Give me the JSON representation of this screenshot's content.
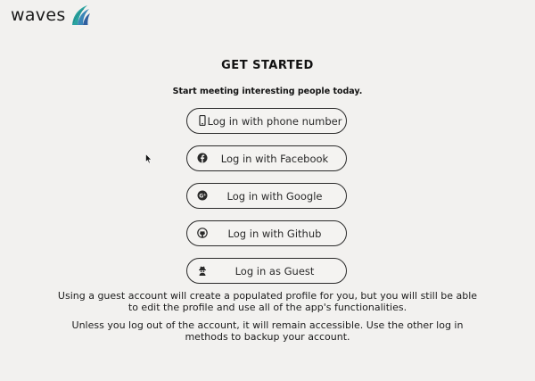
{
  "brand": {
    "name": "waves",
    "logo_icon": "waves-logo-icon"
  },
  "header": {
    "title": "GET STARTED",
    "subtitle": "Start meeting interesting people today."
  },
  "login_options": [
    {
      "label": "Log in with phone number",
      "icon": "phone-icon"
    },
    {
      "label": "Log in with Facebook",
      "icon": "facebook-icon"
    },
    {
      "label": "Log in with Google",
      "icon": "google-plus-icon"
    },
    {
      "label": "Log in with Github",
      "icon": "github-icon"
    },
    {
      "label": "Log in as Guest",
      "icon": "guest-icon"
    }
  ],
  "notes": {
    "guest_info": "Using a guest account will create a populated profile for you, but you will still be able to edit the profile and use all of the app's functionalities.",
    "logout_info": "Unless you log out of the account, it will remain accessible. Use the other log in methods to backup your account."
  },
  "colors": {
    "background": "#f2f1ef",
    "button_border": "#2a2a2a",
    "logo_teal": "#2aa3a0",
    "logo_blue": "#3b6fb0"
  }
}
